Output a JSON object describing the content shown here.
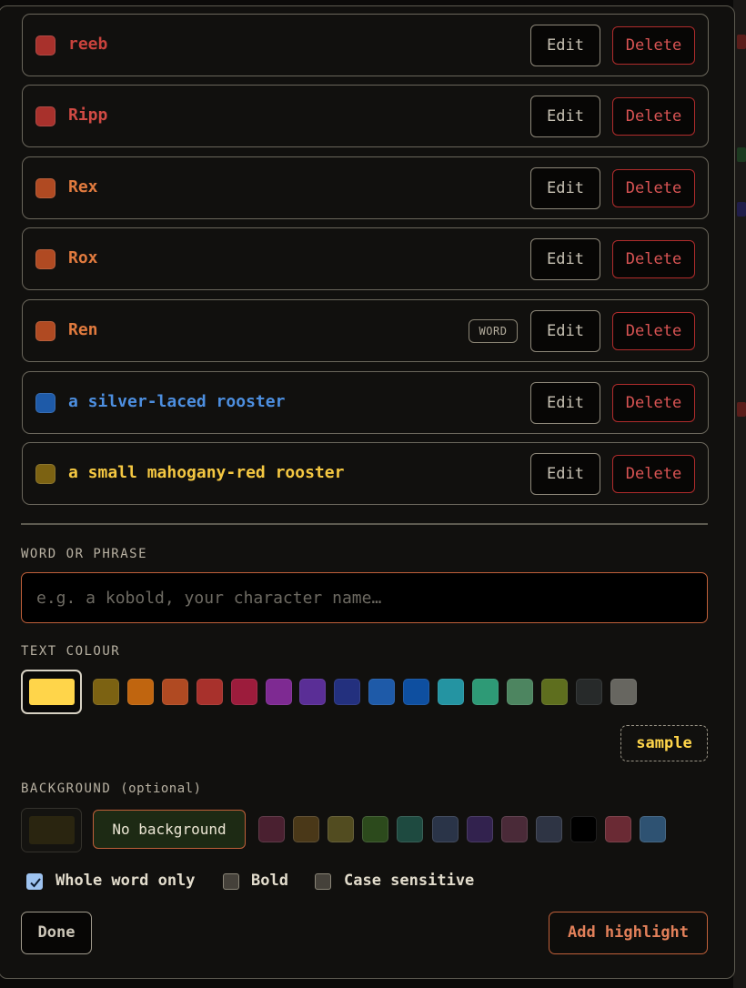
{
  "rules": [
    {
      "label": "reeb",
      "color": "#c8423c",
      "swatch": "#a8312c",
      "word_badge": ""
    },
    {
      "label": "Ripp",
      "color": "#d04a44",
      "swatch": "#a8312c",
      "word_badge": ""
    },
    {
      "label": "Rex",
      "color": "#e07a3e",
      "swatch": "#b04a22",
      "word_badge": ""
    },
    {
      "label": "Rox",
      "color": "#e07a3e",
      "swatch": "#b04a22",
      "word_badge": ""
    },
    {
      "label": "Ren",
      "color": "#e07a3e",
      "swatch": "#b04a22",
      "word_badge": "WORD"
    },
    {
      "label": "a silver-laced rooster",
      "color": "#4d8fe0",
      "swatch": "#1e5aa8",
      "word_badge": ""
    },
    {
      "label": "a small mahogany-red rooster",
      "color": "#f5c842",
      "swatch": "#7c6212",
      "word_badge": ""
    }
  ],
  "edit_label": "Edit",
  "delete_label": "Delete",
  "word_section": {
    "label": "WORD OR PHRASE",
    "placeholder": "e.g. a kobold, your character name…",
    "value": ""
  },
  "text_colour": {
    "label": "TEXT COLOUR",
    "selected": "#ffd54a",
    "swatches": [
      "#7c6212",
      "#c0650f",
      "#b04a22",
      "#a8312c",
      "#9c1c3c",
      "#7e2a92",
      "#5a2e96",
      "#23307e",
      "#1e5aa8",
      "#0e4fa0",
      "#2494a2",
      "#2e9a76",
      "#4d8560",
      "#5e6e1e",
      "#272a2a",
      "#676660"
    ],
    "sample_label": "sample"
  },
  "background": {
    "label": "BACKGROUND",
    "optional_label": "(optional)",
    "selected": "#2a2510",
    "no_background_label": "No background",
    "swatches": [
      "#4a2030",
      "#4a3818",
      "#524c20",
      "#2c4a1c",
      "#1e4a40",
      "#2a3448",
      "#32224e",
      "#4a2a38",
      "#2e3444",
      "#000000",
      "#6a2a34",
      "#2e5272"
    ]
  },
  "options": {
    "whole_word": {
      "label": "Whole word only",
      "checked": true
    },
    "bold": {
      "label": "Bold",
      "checked": false
    },
    "case_sensitive": {
      "label": "Case sensitive",
      "checked": false
    }
  },
  "done_label": "Done",
  "add_label": "Add highlight"
}
